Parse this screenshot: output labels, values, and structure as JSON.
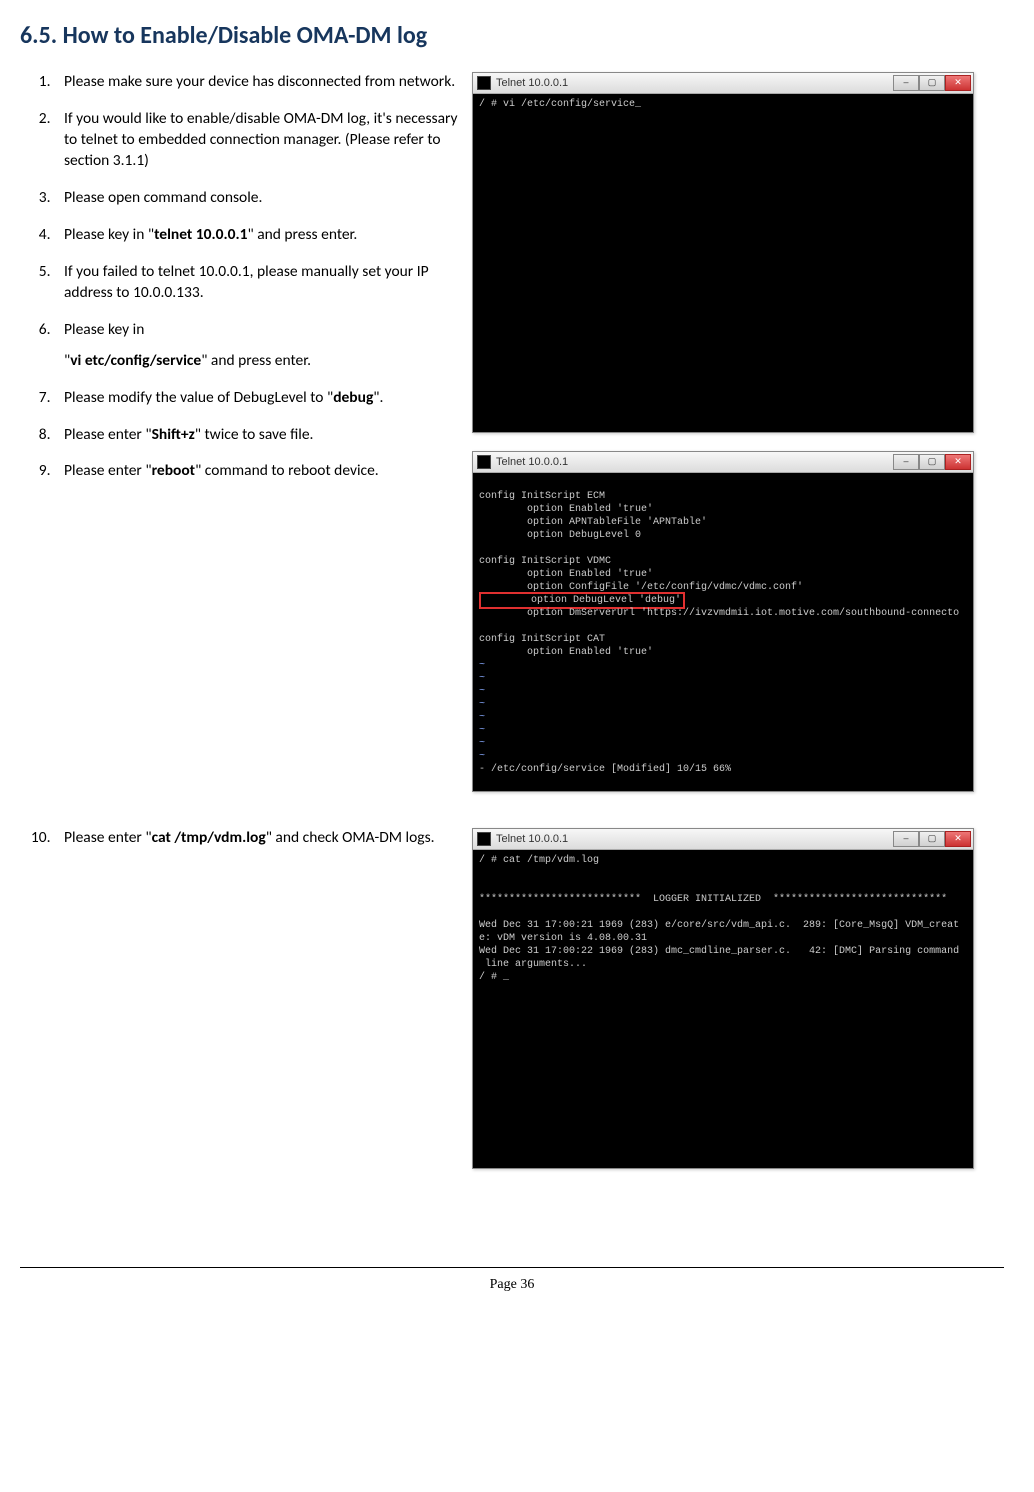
{
  "heading": "6.5. How to Enable/Disable OMA-DM log",
  "steps": {
    "s1": "Please make sure your device has disconnected from network.",
    "s2": "If you would like to enable/disable OMA-DM log, it's necessary to telnet to embedded connection manager. (Please refer to section 3.1.1)",
    "s3": "Please open command console.",
    "s4_pre": "Please key in \"",
    "s4_cmd": "telnet 10.0.0.1",
    "s4_post": "\" and press enter.",
    "s5": "If you failed to telnet 10.0.0.1, please manually set your IP address to 10.0.0.133.",
    "s6": "Please key in",
    "s6b_pre": "\"",
    "s6b_cmd": "vi etc/config/service",
    "s6b_post": "\" and press enter.",
    "s7_pre": "Please modify the value of DebugLevel to \"",
    "s7_cmd": "debug",
    "s7_post": "\".",
    "s8_pre": "Please enter \"",
    "s8_cmd": "Shift+z",
    "s8_post": "\" twice to save file.",
    "s9_pre": "Please enter \"",
    "s9_cmd": "reboot",
    "s9_post": "\" command to reboot device.",
    "s10_pre": "Please enter \"",
    "s10_cmd": "cat /tmp/vdm.log",
    "s10_post": "\" and check OMA-DM logs."
  },
  "windows": {
    "title": "Telnet 10.0.0.1",
    "t1_line": "/ # vi /etc/config/service_",
    "t2_lines": "\nconfig InitScript ECM\n        option Enabled 'true'\n        option APNTableFile 'APNTable'\n        option DebugLevel 0\n\nconfig InitScript VDMC\n        option Enabled 'true'\n        option ConfigFile '/etc/config/vdmc/vdmc.conf'\n",
    "t2_hl": "        option DebugLevel 'debug'",
    "t2_after": "\n        option DmServerUrl 'https://ivzvmdmii.iot.motive.com/southbound-connecto\n\nconfig InitScript CAT\n        option Enabled 'true'\n",
    "t2_tildes": "~\n~\n~\n~\n~\n~\n~\n~",
    "t2_status": "- /etc/config/service [Modified] 10/15 66%",
    "t3_lines": "/ # cat /tmp/vdm.log\n\n\n***************************  LOGGER INITIALIZED  *****************************\n\nWed Dec 31 17:00:21 1969 (283) e/core/src/vdm_api.c.  289: [Core_MsgQ] VDM_creat\ne: vDM version is 4.08.00.31\nWed Dec 31 17:00:22 1969 (283) dmc_cmdline_parser.c.   42: [DMC] Parsing command\n line arguments...\n/ # _"
  },
  "page": "Page 36"
}
